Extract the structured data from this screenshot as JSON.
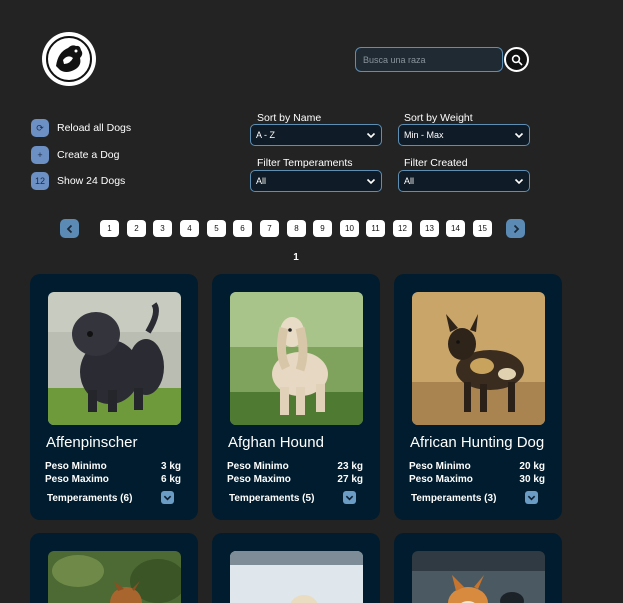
{
  "header": {
    "logo_icon": "dog-silhouette-logo",
    "search_placeholder": "Busca una raza",
    "search_value": "",
    "search_icon": "search-icon"
  },
  "actions": [
    {
      "label": "Reload all Dogs",
      "icon": "reload-icon",
      "glyph": "⟳"
    },
    {
      "label": "Create a Dog",
      "icon": "plus-icon",
      "glyph": "+"
    },
    {
      "label": "Show 24 Dogs",
      "icon": "count-badge-icon",
      "glyph": "12"
    }
  ],
  "filters": {
    "sort_name": {
      "label": "Sort by Name",
      "value": "A - Z"
    },
    "sort_weight": {
      "label": "Sort by Weight",
      "value": "Min - Max"
    },
    "temperaments": {
      "label": "Filter Temperaments",
      "value": "All"
    },
    "created": {
      "label": "Filter Created",
      "value": "All"
    }
  },
  "pagination": {
    "pages": [
      "1",
      "2",
      "3",
      "4",
      "5",
      "6",
      "7",
      "8",
      "9",
      "10",
      "11",
      "12",
      "13",
      "14",
      "15"
    ],
    "current": "1"
  },
  "card_labels": {
    "min": "Peso Minimo",
    "max": "Peso Maximo"
  },
  "cards": [
    {
      "name": "Affenpinscher",
      "min": "3 kg",
      "max": "6 kg",
      "temperaments": "Temperaments (6)"
    },
    {
      "name": "Afghan Hound",
      "min": "23 kg",
      "max": "27 kg",
      "temperaments": "Temperaments (5)"
    },
    {
      "name": "African Hunting Dog",
      "min": "20 kg",
      "max": "30 kg",
      "temperaments": "Temperaments (3)"
    }
  ],
  "colors": {
    "background": "#232323",
    "card": "#001c2e",
    "accent": "#5b8bb5"
  }
}
